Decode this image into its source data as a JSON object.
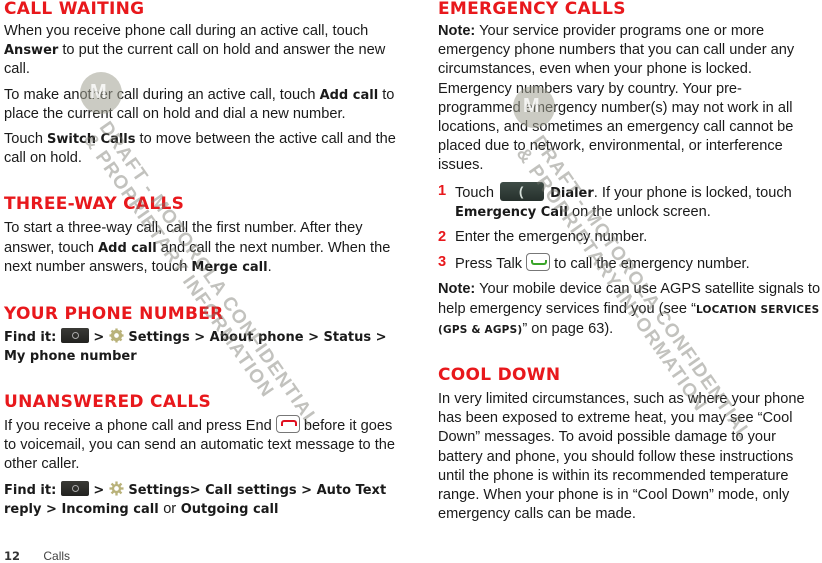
{
  "left": {
    "call_waiting": {
      "title": "Call Waiting",
      "p1": [
        "When you receive phone call during an active call, touch ",
        "Answer",
        " to put the current call on hold and answer the new call."
      ],
      "p2": [
        "To make another call during an active call, touch ",
        "Add call",
        " to place the current call on hold and dial a new number."
      ],
      "p3": [
        "Touch ",
        "Switch Calls",
        " to move between the active call and the call on hold."
      ]
    },
    "three_way": {
      "title": "Three-way Calls",
      "p1": [
        "To start a three-way call, call the first number. After they answer, touch ",
        "Add call",
        " and call the next number. When the next number answers, touch ",
        "Merge call",
        "."
      ]
    },
    "phone_number": {
      "title": "Your Phone Number",
      "find_it": "Find it:",
      "sep": ">",
      "path": [
        "Settings",
        "About phone",
        "Status",
        "My phone number"
      ]
    },
    "unanswered": {
      "title": "Unanswered Calls",
      "p1a": "If you receive a phone call and press End",
      "p1b": "before it goes to voicemail, you can send an automatic text message to the other caller.",
      "find_it": "Find it:",
      "path": [
        "Settings",
        "Call settings",
        "Auto Text reply",
        "Incoming call"
      ],
      "or": "or",
      "last": "Outgoing call"
    }
  },
  "right": {
    "emergency": {
      "title": "Emergency Calls",
      "note_label": "Note:",
      "note_text": " Your service provider programs one or more emergency phone numbers that you can call under any circumstances, even when your phone is locked. Emergency numbers vary by country. Your pre-programmed emergency number(s) may not work in all locations, and sometimes an emergency call cannot be placed due to network, environmental, or interference issues.",
      "steps": [
        {
          "num": "1",
          "a": "Touch",
          "b": "Dialer",
          "c": ". If your phone is locked, touch ",
          "d": "Emergency Call",
          "e": " on the unlock screen."
        },
        {
          "num": "2",
          "text": "Enter the emergency number."
        },
        {
          "num": "3",
          "a": "Press Talk",
          "b": "to call the emergency number."
        }
      ],
      "note2_label": "Note:",
      "note2_text": " Your mobile device can use AGPS satellite signals to help emergency services find you (see “",
      "note2_link": "Location Services (GPS & AGPS)",
      "note2_end": "” on page 63)."
    },
    "cool_down": {
      "title": "Cool Down",
      "p1": "In very limited circumstances, such as where your phone has been exposed to extreme heat, you may see “Cool Down” messages. To avoid possible damage to your battery and phone, you should follow these instructions until the phone is within its recommended temperature range. When your phone is in “Cool Down” mode, only emergency calls can be made."
    }
  },
  "footer": {
    "page": "12",
    "section": "Calls"
  },
  "watermark": {
    "line1": "DRAFT - MOTOROLA CONFIDENTIAL",
    "line2": "& PROPRIETARY INFORMATION"
  },
  "colors": {
    "heading": "#e8181c"
  }
}
